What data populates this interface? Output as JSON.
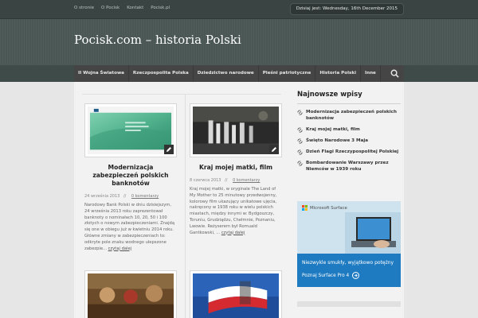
{
  "topbar": {
    "nav": [
      "O stronie",
      "O Pocisk",
      "Kontakt",
      "Pocisk.pl"
    ],
    "date": "Dzisiaj jest: Wednesday, 16th December 2015"
  },
  "header": {
    "site_title": "Pocisk.com – historia Polski"
  },
  "mainnav": {
    "items": [
      "II Wojna Światowa",
      "Rzeczpospolita Polska",
      "Dziedzictwo narodowe",
      "Pieśni patriotyczne",
      "Historia Polski",
      "Inne"
    ],
    "search_icon": "search-icon"
  },
  "posts": [
    {
      "title": "Modernizacja zabezpieczeń polskich banknotów",
      "date": "24 września 2013",
      "sep": "//",
      "comments": "0 komentarzy",
      "excerpt": "Narodowy Bank Polski w dniu dzisiejszym, 24 września 2013 roku zaprezentował banknoty o nominałach 10, 20, 50 i 100 złotych o nowym zabezpieczeniami. Znajdą się one w obiegu już w kwietniu 2014 roku. Główne zmiany w zabezpieczeniach to: odkryte pole znaku wodnego ulepszone zabezpie...",
      "more": "czytaj dalej"
    },
    {
      "title": "Kraj mojej matki, film",
      "date": "8 czerwca 2013",
      "sep": "//",
      "comments": "0 komentarzy",
      "excerpt": "Kraj mojej matki, w oryginale The Land of My Mother to 25 minutowy przedwojenny, kolorowy film ukazujący unikatowe ujęcia, nakręcony w 1938 roku w wielu polskich miastach, między innymi w: Bydgoszczy, Toruniu, Grudziądzu, Chełmnie, Poznaniu, Lwowie. Reżyserem był Romuald Gantkowski, ...",
      "more": "czytaj dalej"
    }
  ],
  "sidebar": {
    "title": "Najnowsze wpisy",
    "items": [
      "Modernizacja zabezpieczeń polskich banknotów",
      "Kraj mojej matki, film",
      "Święto Narodowe 3 Maja",
      "Dzień Flagi Rzeczypospolitej Polskiej",
      "Bombardowanie Warszawy przez Niemców w 1939 roku"
    ]
  },
  "ad": {
    "brand": "Microsoft Surface",
    "tagline": "Niezwykle smukły, wyjątkowo potężny",
    "cta": "Poznaj Surface Pro 4"
  },
  "colors": {
    "nav_bg": "#454545",
    "header_bg": "#4f5c59",
    "ad_blue": "#1f7bc1"
  }
}
